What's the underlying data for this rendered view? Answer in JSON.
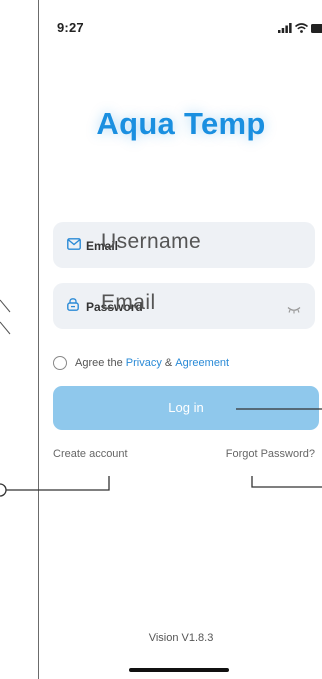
{
  "status_bar": {
    "time": "9:27"
  },
  "app": {
    "logo_text": "Aqua Temp"
  },
  "email_field": {
    "label": "Email",
    "overlay_text": "Username"
  },
  "password_field": {
    "label": "Password",
    "overlay_text": "Email"
  },
  "agreement": {
    "prefix": "Agree the",
    "privacy_link": "Privacy",
    "ampersand": "&",
    "agreement_link": "Agreement"
  },
  "login_button": {
    "label": "Log in"
  },
  "create_account": {
    "label": "Create account"
  },
  "forgot_password": {
    "label": "Forgot Password?"
  },
  "version": {
    "label": "Vision V1.8.3"
  },
  "colors": {
    "accent": "#1a8fe0",
    "button": "#8fc8ec",
    "link": "#2a8ad6",
    "field_bg": "#eef1f5"
  },
  "icons": [
    "signal-icon",
    "wifi-icon",
    "battery-icon",
    "mail-icon",
    "lock-icon",
    "eye-closed-icon",
    "radio-icon"
  ]
}
